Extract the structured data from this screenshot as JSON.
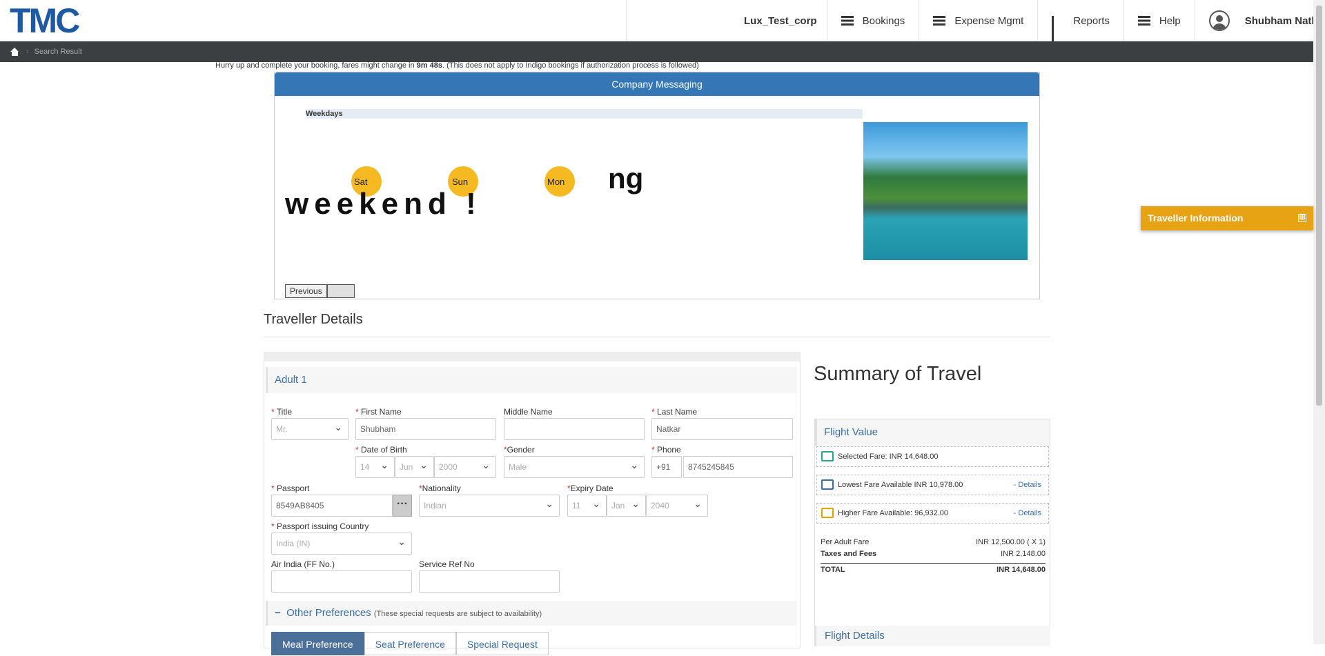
{
  "logo": "TMC",
  "header": {
    "corp": "Lux_Test_corp",
    "nav": [
      "Bookings",
      "Expense Mgmt",
      "Reports",
      "Help"
    ],
    "user": "Shubham Natkar"
  },
  "breadcrumb": {
    "current": "Search Result"
  },
  "warning": {
    "pre": "Hurry up and complete your booking, fares might change in ",
    "time": "9m 48s",
    "post": ". (This does not apply to Indigo bookings if authorization process is followed)"
  },
  "messaging": {
    "title": "Company Messaging",
    "subtitle": "Weekdays",
    "banner_top": "ng",
    "banner_bottom": "weekend !",
    "suns": [
      "Sat",
      "Sun",
      "Mon"
    ],
    "prev": "Previous"
  },
  "traveller_panel": {
    "label": "Traveller Information",
    "icon": "⊞"
  },
  "traveller": {
    "heading": "Traveller Details",
    "adult": "Adult 1",
    "labels": {
      "title": "Title",
      "first": "First Name",
      "middle": "Middle Name",
      "last": "Last Name",
      "dob": "Date of Birth",
      "gender": "Gender",
      "phone": "Phone",
      "passport": "Passport",
      "nationality": "Nationality",
      "expiry": "Expiry Date",
      "country": "Passport issuing Country",
      "ff": "Air India (FF No.)",
      "sref": "Service Ref No"
    },
    "values": {
      "title": "Mr.",
      "first": "Shubham",
      "middle": "",
      "last": "Natkar",
      "dob_d": "14",
      "dob_m": "Jun",
      "dob_y": "2000",
      "gender": "Male",
      "cc": "+91",
      "phone": "8745245845",
      "passport": "8549AB8405",
      "nationality": "Indian",
      "exp_d": "11",
      "exp_m": "Jan",
      "exp_y": "2040",
      "country": "India (IN)",
      "ff": "",
      "sref": ""
    },
    "other": {
      "title": "Other Preferences",
      "note": "(These special requests are subject to availability)",
      "toggle": "−"
    },
    "tabs": [
      "Meal Preference",
      "Seat Preference",
      "Special Request"
    ]
  },
  "summary": {
    "heading": "Summary of Travel",
    "flight_value": "Flight Value",
    "selected": "Selected Fare: INR 14,648.00",
    "lowest": "Lowest Fare Available INR 10,978.00",
    "higher": "Higher Fare Available: 96,932.00",
    "details": "Details",
    "rows": [
      {
        "k": "Per Adult Fare",
        "v": "INR 12,500.00 ( X 1)"
      },
      {
        "k": "Taxes and Fees",
        "v": "INR 2,148.00"
      }
    ],
    "total": {
      "k": "TOTAL",
      "v": "INR 14,648.00"
    },
    "flight_details": "Flight Details"
  },
  "colors": {
    "brand": "#1d5aa3",
    "accent": "#e7a313",
    "header_bar": "#3476b6"
  }
}
